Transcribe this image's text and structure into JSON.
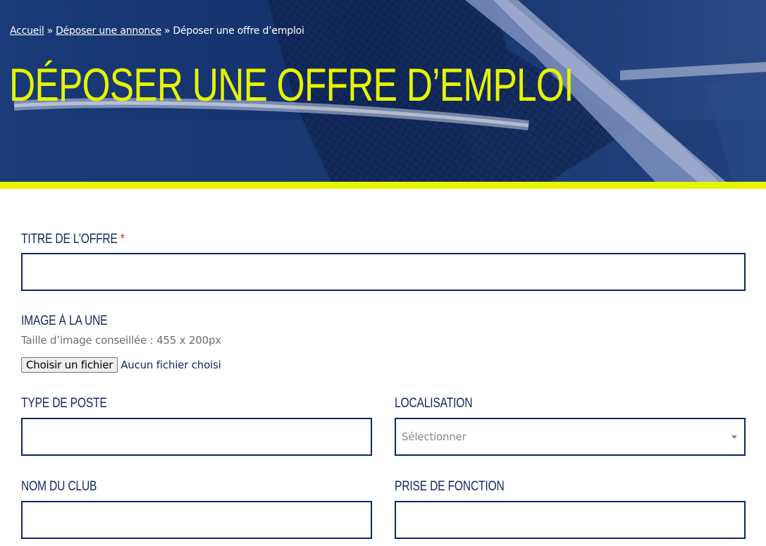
{
  "breadcrumb": {
    "home": "Accueil",
    "separator": "»",
    "parent": "Déposer une annonce",
    "current": "Déposer une offre d’emploi"
  },
  "page": {
    "title": "DÉPOSER UNE OFFRE D’EMPLOI"
  },
  "colors": {
    "brand_navy": "#10285e",
    "accent_yellow": "#e6f500",
    "required_red": "#e02b2b"
  },
  "form": {
    "title_field": {
      "label": "TITRE DE L’OFFRE",
      "required_marker": "*",
      "value": ""
    },
    "image_field": {
      "label": "IMAGE À LA UNE",
      "hint": "Taille d’image conseillée : 455 x 200px",
      "button_label": "Choisir un fichier",
      "status": "Aucun fichier choisi"
    },
    "job_type_field": {
      "label": "TYPE DE POSTE",
      "value": ""
    },
    "location_field": {
      "label": "LOCALISATION",
      "selected": "Sélectionner",
      "icon": "chevron-down-icon"
    },
    "club_name_field": {
      "label": "NOM DU CLUB",
      "value": ""
    },
    "start_date_field": {
      "label": "PRISE DE FONCTION",
      "value": ""
    }
  }
}
